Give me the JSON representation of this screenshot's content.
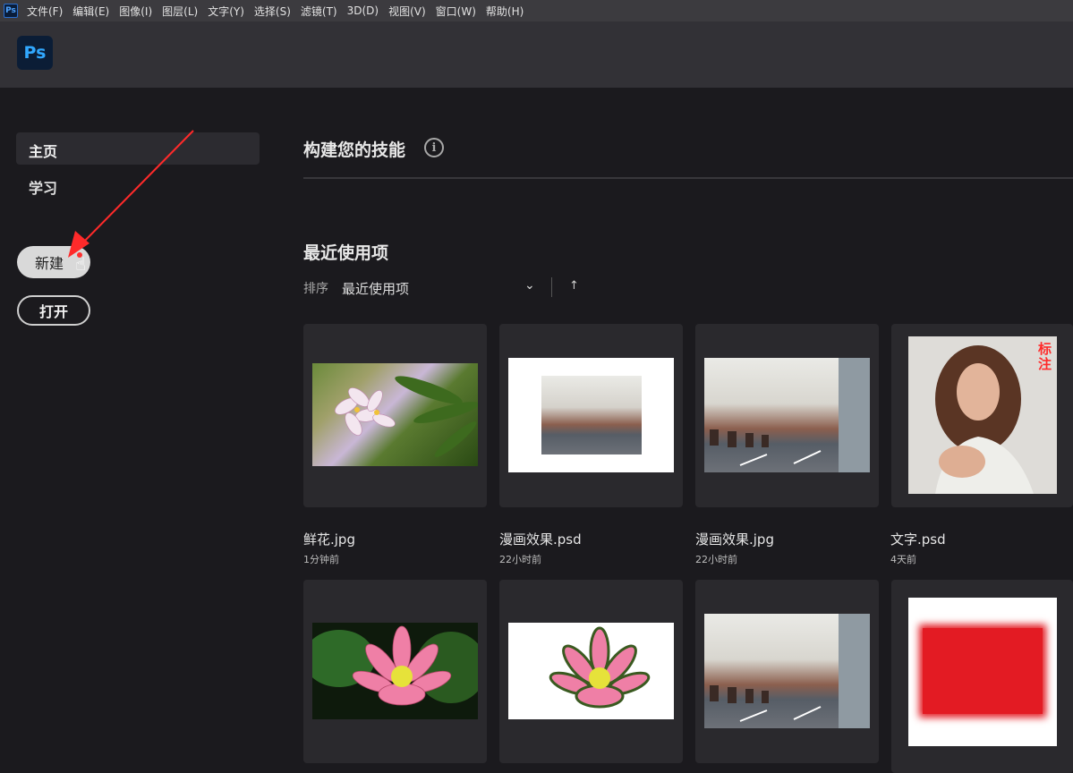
{
  "menubar": {
    "app_icon": "Ps",
    "items": [
      "文件(F)",
      "编辑(E)",
      "图像(I)",
      "图层(L)",
      "文字(Y)",
      "选择(S)",
      "滤镜(T)",
      "3D(D)",
      "视图(V)",
      "窗口(W)",
      "帮助(H)"
    ]
  },
  "header": {
    "logo": "Ps"
  },
  "nav": {
    "home": "主页",
    "learn": "学习"
  },
  "buttons": {
    "new": "新建",
    "open": "打开"
  },
  "main": {
    "skills_title": "构建您的技能",
    "info_icon": "i",
    "recent_title": "最近使用项",
    "sort_label": "排序",
    "sort_value": "最近使用项",
    "chevron_icon": "⌄",
    "sort_dir_icon": "↑"
  },
  "files": [
    {
      "name": "鲜花.jpg",
      "time": "1分钟前"
    },
    {
      "name": "漫画效果.psd",
      "time": "22小时前"
    },
    {
      "name": "漫画效果.jpg",
      "time": "22小时前"
    },
    {
      "name": "文字.psd",
      "time": "4天前"
    }
  ],
  "thumb_text": {
    "annotation": "标\n注"
  },
  "colors": {
    "accent_red": "#ff2a2a",
    "ps_blue": "#31a8ff",
    "bg": "#1b1a1e"
  }
}
